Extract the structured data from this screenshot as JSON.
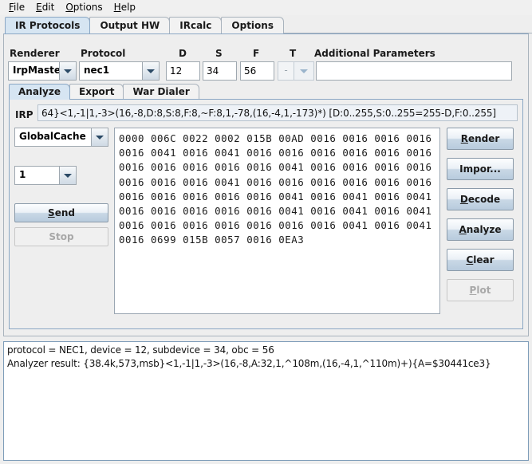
{
  "menu": {
    "items": [
      {
        "label": "File",
        "mnemonic": "F"
      },
      {
        "label": "Edit",
        "mnemonic": "E"
      },
      {
        "label": "Options",
        "mnemonic": "O"
      },
      {
        "label": "Help",
        "mnemonic": "H"
      }
    ]
  },
  "main_tabs": [
    {
      "label": "IR Protocols",
      "selected": true
    },
    {
      "label": "Output HW",
      "selected": false
    },
    {
      "label": "IRcalc",
      "selected": false
    },
    {
      "label": "Options",
      "selected": false
    }
  ],
  "form": {
    "renderer_label": "Renderer",
    "renderer_value": "IrpMaster",
    "protocol_label": "Protocol",
    "protocol_value": "nec1",
    "d_label": "D",
    "d_value": "12",
    "s_label": "S",
    "s_value": "34",
    "f_label": "F",
    "f_value": "56",
    "t_label": "T",
    "t_value": "-",
    "additional_params_label": "Additional Parameters",
    "additional_params_value": ""
  },
  "inner_tabs": [
    {
      "label": "Analyze",
      "selected": true
    },
    {
      "label": "Export",
      "selected": false
    },
    {
      "label": "War Dialer",
      "selected": false
    }
  ],
  "irp": {
    "label": "IRP",
    "value": "64}<1,-1|1,-3>(16,-8,D:8,S:8,F:8,~F:8,1,-78,(16,-4,1,-173)*) [D:0..255,S:0..255=255-D,F:0..255]"
  },
  "left_controls": {
    "hardware_value": "GlobalCache",
    "count_value": "1",
    "send_label": "Send",
    "send_mnemonic": "S",
    "stop_label": "Stop",
    "stop_disabled": true
  },
  "hex_data": {
    "lines": [
      "0000 006C 0022 0002 015B 00AD 0016 0016 0016 0016",
      "0016 0041 0016 0041 0016 0016 0016 0016 0016 0016",
      "0016 0016 0016 0016 0016 0041 0016 0016 0016 0016",
      "0016 0016 0016 0041 0016 0016 0016 0016 0016 0016",
      "0016 0016 0016 0016 0016 0041 0016 0041 0016 0041",
      "0016 0016 0016 0016 0016 0041 0016 0041 0016 0041",
      "0016 0016 0016 0016 0016 0016 0016 0041 0016 0041",
      "0016 0699 015B 0057 0016 0EA3"
    ]
  },
  "right_buttons": [
    {
      "label": "Render",
      "mnemonic": "R",
      "disabled": false
    },
    {
      "label": "Impor...",
      "mnemonic": "",
      "disabled": false
    },
    {
      "label": "Decode",
      "mnemonic": "D",
      "disabled": false
    },
    {
      "label": "Analyze",
      "mnemonic": "A",
      "disabled": false
    },
    {
      "label": "Clear",
      "mnemonic": "C",
      "disabled": false
    },
    {
      "label": "Plot",
      "mnemonic": "P",
      "disabled": true
    }
  ],
  "output": {
    "line1": "protocol = NEC1, device = 12, subdevice = 34, obc = 56",
    "line2": "Analyzer result: {38.4k,573,msb}<1,-1|1,-3>(16,-8,A:32,1,^108m,(16,-4,1,^110m)+){A=$30441ce3}"
  },
  "colors": {
    "panel_bg": "#eeeeee",
    "tab_selected": "#d6e5f2",
    "border": "#a9b3bd",
    "field_bg": "#ffffff"
  }
}
